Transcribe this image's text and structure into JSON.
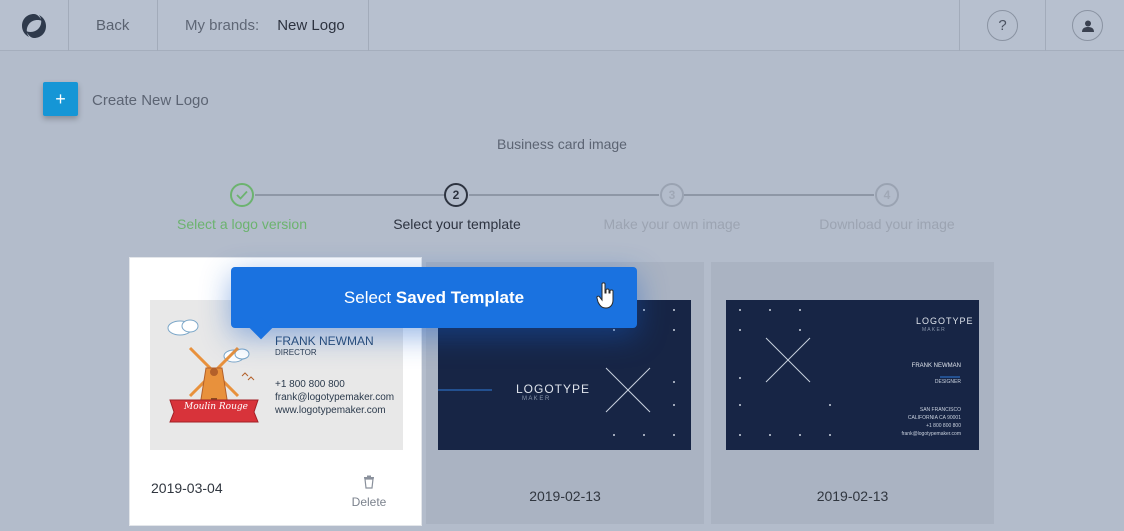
{
  "header": {
    "back_label": "Back",
    "brands_label": "My brands:",
    "brand_value": "New Logo",
    "help_label": "?"
  },
  "create": {
    "button_label": "+",
    "label": "Create New Logo"
  },
  "section_title": "Business card image",
  "steps": [
    {
      "number": "",
      "label": "Select a logo version",
      "state": "done"
    },
    {
      "number": "2",
      "label": "Select your template",
      "state": "active"
    },
    {
      "number": "3",
      "label": "Make your own image",
      "state": "pending"
    },
    {
      "number": "4",
      "label": "Download your image",
      "state": "pending"
    }
  ],
  "tooltip": {
    "prefix": "Select ",
    "bold": "Saved Template"
  },
  "cards": [
    {
      "date": "2019-03-04",
      "delete_label": "Delete",
      "card_name": "FRANK NEWMAN",
      "card_title": "DIRECTOR",
      "card_phone": "+1 800 800 800",
      "card_email": "frank@logotypemaker.com",
      "card_web": "www.logotypemaker.com",
      "banner_text": "Moulin Rouge"
    },
    {
      "date": "2019-02-13",
      "logo_text": "LOGOTYPE",
      "logo_sub": "M A K E R"
    },
    {
      "date": "2019-02-13",
      "logo_text": "LOGOTYPE",
      "logo_sub": "M A K E R",
      "card_name": "FRANK NEWMAN",
      "card_title": "DESIGNER",
      "card_city": "SAN FRANCISCO",
      "card_state": "CALIFORNIA CA 90001",
      "card_phone": "+1 800 800 800",
      "card_email": "frank@logotypemaker.com"
    }
  ],
  "colors": {
    "accent": "#1a72e0",
    "success": "#6cb36f",
    "create_button": "#1596d6",
    "card_dark": "#172545"
  }
}
